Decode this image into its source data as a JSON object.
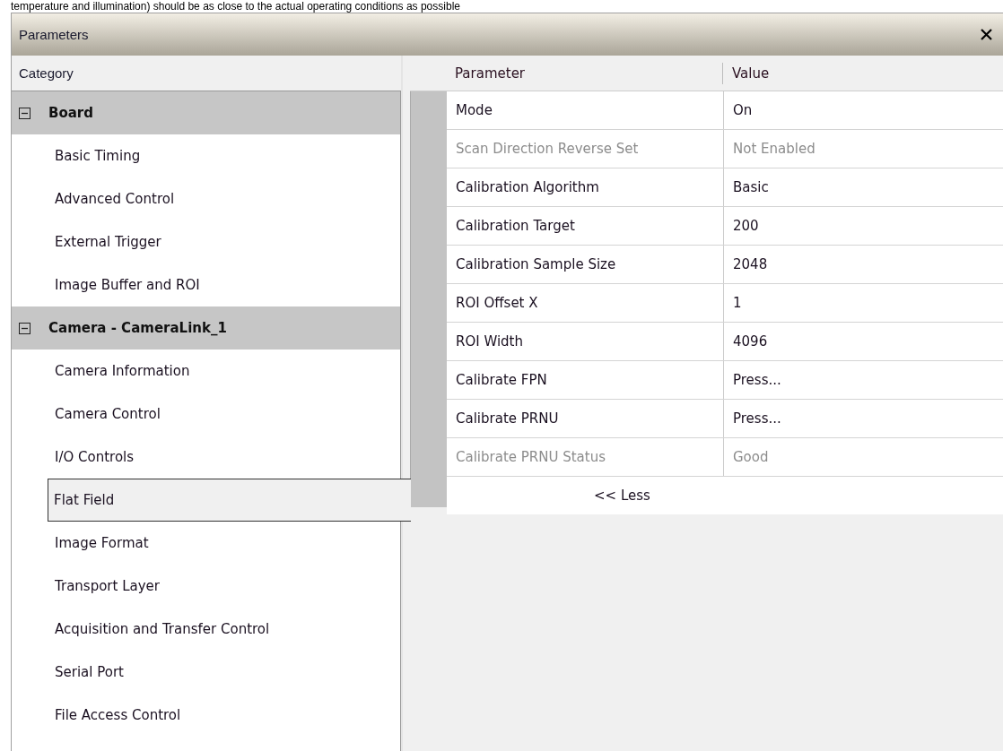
{
  "document_text": "temperature and illumination) should be as close to the actual operating conditions as possible",
  "window": {
    "title": "Parameters"
  },
  "category_header": "Category",
  "categories": [
    {
      "label": "Board",
      "expanded": true,
      "children": [
        {
          "label": "Basic Timing",
          "selected": false
        },
        {
          "label": "Advanced Control",
          "selected": false
        },
        {
          "label": "External Trigger",
          "selected": false
        },
        {
          "label": "Image Buffer and ROI",
          "selected": false
        }
      ]
    },
    {
      "label": "Camera - CameraLink_1",
      "expanded": true,
      "children": [
        {
          "label": "Camera Information",
          "selected": false
        },
        {
          "label": "Camera Control",
          "selected": false
        },
        {
          "label": "I/O Controls",
          "selected": false
        },
        {
          "label": "Flat Field",
          "selected": true
        },
        {
          "label": "Image Format",
          "selected": false
        },
        {
          "label": "Transport Layer",
          "selected": false
        },
        {
          "label": "Acquisition and Transfer Control",
          "selected": false
        },
        {
          "label": "Serial Port",
          "selected": false
        },
        {
          "label": "File Access Control",
          "selected": false
        }
      ]
    }
  ],
  "table": {
    "columns": [
      "Parameter",
      "Value"
    ],
    "rows": [
      {
        "parameter": "Mode",
        "value": "On",
        "disabled": false
      },
      {
        "parameter": "Scan Direction Reverse Set",
        "value": "Not Enabled",
        "disabled": true
      },
      {
        "parameter": "Calibration Algorithm",
        "value": "Basic",
        "disabled": false
      },
      {
        "parameter": "Calibration Target",
        "value": "200",
        "disabled": false
      },
      {
        "parameter": "Calibration Sample Size",
        "value": "2048",
        "disabled": false
      },
      {
        "parameter": "ROI Offset X",
        "value": "1",
        "disabled": false
      },
      {
        "parameter": "ROI Width",
        "value": "4096",
        "disabled": false
      },
      {
        "parameter": "Calibrate FPN",
        "value": "Press...",
        "disabled": false
      },
      {
        "parameter": "Calibrate PRNU",
        "value": "Press...",
        "disabled": false
      },
      {
        "parameter": "Calibrate PRNU Status",
        "value": "Good",
        "disabled": true
      }
    ]
  },
  "less_button": "<< Less"
}
